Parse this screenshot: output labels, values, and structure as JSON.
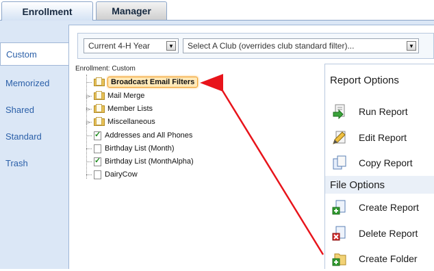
{
  "tabs": [
    {
      "label": "Enrollment",
      "active": true
    },
    {
      "label": "Manager",
      "active": false
    }
  ],
  "sidebar": {
    "items": [
      {
        "label": "Custom",
        "selected": true
      },
      {
        "label": "Memorized",
        "selected": false
      },
      {
        "label": "Shared",
        "selected": false
      },
      {
        "label": "Standard",
        "selected": false
      },
      {
        "label": "Trash",
        "selected": false
      }
    ]
  },
  "filters": {
    "year_select": "Current 4-H Year",
    "club_select": "Select A Club (overrides club standard filter)..."
  },
  "tree": {
    "root": "Enrollment: Custom",
    "nodes": [
      {
        "label": "Broadcast Email Filters",
        "type": "folder"
      },
      {
        "label": "Mail Merge",
        "type": "folder"
      },
      {
        "label": "Member Lists",
        "type": "folder"
      },
      {
        "label": "Miscellaneous",
        "type": "folder"
      },
      {
        "label": "Addresses and All Phones",
        "type": "report-checked"
      },
      {
        "label": "Birthday List (Month)",
        "type": "report"
      },
      {
        "label": "Birthday List (MonthAlpha)",
        "type": "report-checked"
      },
      {
        "label": "DairyCow",
        "type": "report"
      }
    ]
  },
  "report_options": {
    "header": "Report Options",
    "items": [
      {
        "label": "Run Report",
        "icon": "run-report-icon"
      },
      {
        "label": "Edit Report",
        "icon": "edit-report-icon"
      },
      {
        "label": "Copy Report",
        "icon": "copy-report-icon"
      }
    ]
  },
  "file_options": {
    "header": "File Options",
    "items": [
      {
        "label": "Create Report",
        "icon": "create-report-icon"
      },
      {
        "label": "Delete Report",
        "icon": "delete-report-icon"
      },
      {
        "label": "Create Folder",
        "icon": "create-folder-icon"
      }
    ]
  },
  "colors": {
    "panel_bg": "#dbe7f6",
    "link_blue": "#2a5fa8",
    "annotation_red": "#e8141b",
    "highlight_orange": "#f0a030"
  }
}
